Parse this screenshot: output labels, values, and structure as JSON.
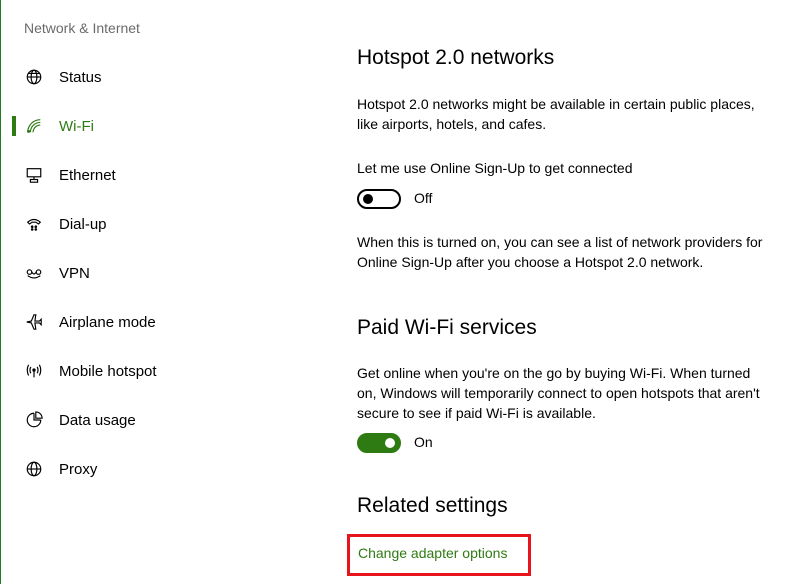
{
  "sidebar": {
    "section_title": "Network & Internet",
    "items": [
      {
        "label": "Status",
        "icon": "globe-status-icon"
      },
      {
        "label": "Wi-Fi",
        "icon": "wifi-icon",
        "active": true
      },
      {
        "label": "Ethernet",
        "icon": "ethernet-icon"
      },
      {
        "label": "Dial-up",
        "icon": "dialup-icon"
      },
      {
        "label": "VPN",
        "icon": "vpn-icon"
      },
      {
        "label": "Airplane mode",
        "icon": "airplane-icon"
      },
      {
        "label": "Mobile hotspot",
        "icon": "hotspot-icon"
      },
      {
        "label": "Data usage",
        "icon": "data-usage-icon"
      },
      {
        "label": "Proxy",
        "icon": "globe-proxy-icon"
      }
    ]
  },
  "main": {
    "hotspot": {
      "heading": "Hotspot 2.0 networks",
      "desc_line1": "Hotspot 2.0 networks might be available in certain public places,",
      "desc_line2": "like airports, hotels, and cafes.",
      "toggle_caption": "Let me use Online Sign-Up to get connected",
      "toggle_state": "Off",
      "note_line1": "When this is turned on, you can see a list of network providers for",
      "note_line2": "Online Sign-Up after you choose a Hotspot 2.0 network."
    },
    "paid": {
      "heading": "Paid Wi-Fi services",
      "desc_line1": "Get online when you're on the go by buying Wi-Fi. When turned",
      "desc_line2": "on, Windows will temporarily connect to open hotspots that aren't",
      "desc_line3": "secure to see if paid Wi-Fi is available.",
      "toggle_state": "On"
    },
    "related": {
      "heading": "Related settings",
      "link": "Change adapter options"
    }
  },
  "colors": {
    "accent": "#2f7b13",
    "highlight_box": "#e8141b",
    "section_title": "#6b6b6b"
  }
}
